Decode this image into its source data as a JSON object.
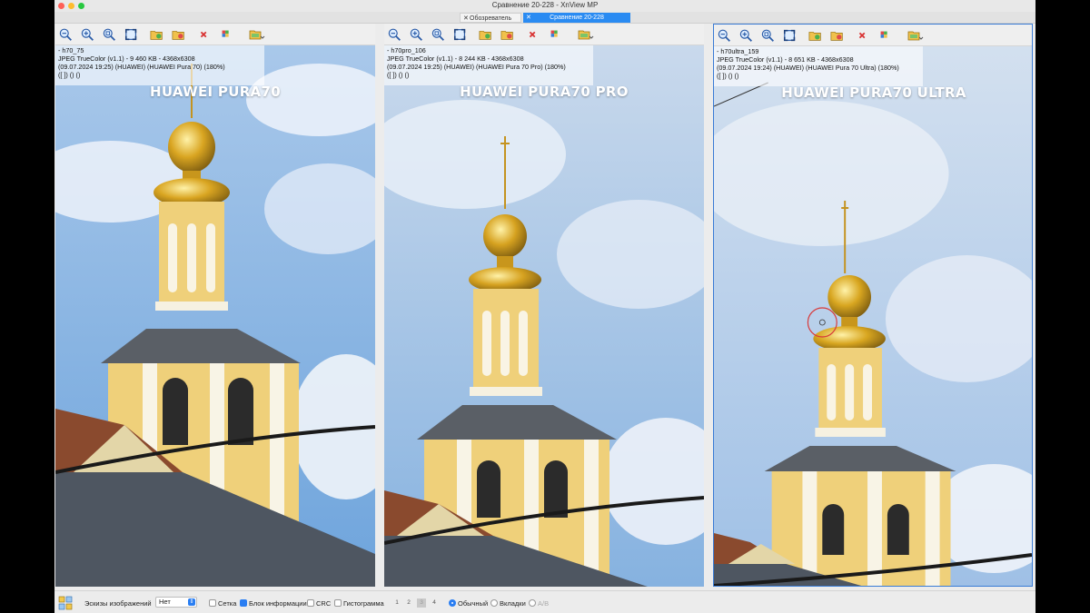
{
  "window": {
    "title": "Сравнение 20-228 - XnView MP"
  },
  "tabs": [
    {
      "label": "Обозреватель",
      "active": false
    },
    {
      "label": "Сравнение 20-228",
      "active": true
    }
  ],
  "panes": [
    {
      "caption": "HUAWEI PURA70",
      "info": [
        "- h70_75",
        "JPEG TrueColor (v1.1) - 9 460 KB - 4368x6308",
        "(09.07.2024 19:25) (HUAWEI) (HUAWEI Pura 70) (180%)",
        "([ ]) () ()"
      ]
    },
    {
      "caption": "HUAWEI PURA70 PRO",
      "info": [
        "- h70pro_106",
        "JPEG TrueColor (v1.1) - 8 244 KB - 4368x6308",
        "(09.07.2024 19:25) (HUAWEI) (HUAWEI Pura 70 Pro) (180%)",
        "([ ]) () ()"
      ]
    },
    {
      "caption": "HUAWEI PURA70 ULTRA",
      "info": [
        "- h70ultra_159",
        "JPEG TrueColor (v1.1) - 8 651 KB - 4368x6308",
        "(09.07.2024 19:24) (HUAWEI) (HUAWEI Pura 70 Ultra) (180%)",
        "([ ]) () ()"
      ]
    }
  ],
  "toolbar_icons": [
    "zoom-out-icon",
    "zoom-in-icon",
    "zoom-fit-icon",
    "fullscreen-icon",
    "open-folder-icon",
    "open-image-icon",
    "close-red-icon",
    "color-picker-icon",
    "folder-menu-icon"
  ],
  "statusbar": {
    "thumbnails_label": "Эскизы изображений",
    "thumbnails_value": "Нет",
    "grid_label": "Сетка",
    "info_block_label": "Блок информации",
    "crc_label": "CRC",
    "histogram_label": "Гистограмма",
    "pages": [
      "1",
      "2",
      "3",
      "4"
    ],
    "mode_normal": "Обычный",
    "mode_tabs": "Вкладки",
    "mode_ab": "A/B"
  },
  "colors": {
    "accent": "#2a7ef2",
    "sky": "#7fb0e0",
    "facade": "#f0d27a",
    "roof": "#4d5560",
    "gold": "#d8a820"
  }
}
